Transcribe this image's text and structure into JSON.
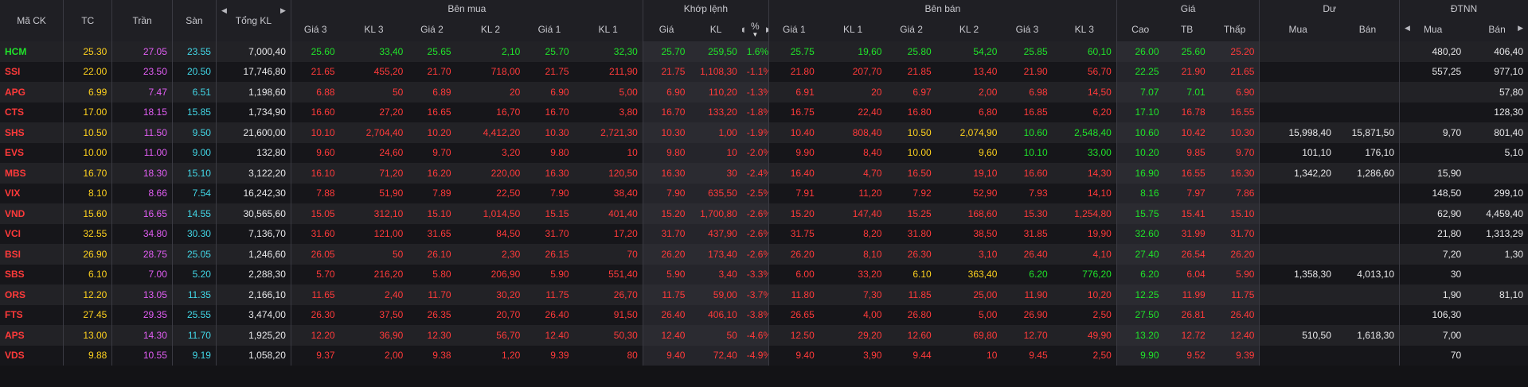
{
  "colors": {
    "up": "#20e32a",
    "down": "#ff3a3a",
    "reference": "#ffd21e",
    "ceiling": "#e35ef5",
    "floor": "#42d8e8",
    "neutral": "#e8e8ea"
  },
  "icons": [
    "arrow-left-icon",
    "arrow-right-icon",
    "sort-desc-icon"
  ],
  "header": {
    "groups": {
      "symbol": "Mã CK",
      "ref": "TC",
      "ceiling": "Trần",
      "floor": "Sàn",
      "total_volume": "Tổng KL",
      "bid": "Bên mua",
      "match": "Khớp lệnh",
      "ask": "Bên bán",
      "price": "Giá",
      "residual": "Dư",
      "foreign": "ĐTNN"
    },
    "sub": {
      "bid_p3": "Giá 3",
      "bid_v3": "KL 3",
      "bid_p2": "Giá 2",
      "bid_v2": "KL 2",
      "bid_p1": "Giá 1",
      "bid_v1": "KL 1",
      "match_p": "Giá",
      "match_v": "KL",
      "match_pct": "%",
      "ask_p1": "Giá 1",
      "ask_v1": "KL 1",
      "ask_p2": "Giá 2",
      "ask_v2": "KL 2",
      "ask_p3": "Giá 3",
      "ask_v3": "KL 3",
      "high": "Cao",
      "avg": "TB",
      "low": "Thấp",
      "res_buy": "Mua",
      "res_sell": "Bán",
      "frn_buy": "Mua",
      "frn_sell": "Bán"
    }
  },
  "rows": [
    {
      "sym": "HCM",
      "ref": "25.30",
      "ceil": "27.05",
      "floor": "23.55",
      "total": "7,000,40",
      "b3": "25.60",
      "bv3": "33,40",
      "b2": "25.65",
      "bv2": "2,10",
      "b1": "25.70",
      "bv1": "32,30",
      "mp": "25.70",
      "mv": "259,50",
      "pct": "1.6%",
      "a1": "25.75",
      "av1": "19,60",
      "a2": "25.80",
      "av2": "54,20",
      "a3": "25.85",
      "av3": "60,10",
      "hi": "26.00",
      "avg": "25.60",
      "lo": "25.20",
      "rb": "",
      "rs": "",
      "fb": "480,20",
      "fs": "406,40",
      "c": {
        "sym": "up",
        "b3": "up",
        "b2": "up",
        "b1": "up",
        "m": "up",
        "a1": "up",
        "a2": "up",
        "a3": "up",
        "hi": "up",
        "avg": "up",
        "lo": "down"
      }
    },
    {
      "sym": "SSI",
      "ref": "22.00",
      "ceil": "23.50",
      "floor": "20.50",
      "total": "17,746,80",
      "b3": "21.65",
      "bv3": "455,20",
      "b2": "21.70",
      "bv2": "718,00",
      "b1": "21.75",
      "bv1": "211,90",
      "mp": "21.75",
      "mv": "1,108,30",
      "pct": "-1.1%",
      "a1": "21.80",
      "av1": "207,70",
      "a2": "21.85",
      "av2": "13,40",
      "a3": "21.90",
      "av3": "56,70",
      "hi": "22.25",
      "avg": "21.90",
      "lo": "21.65",
      "rb": "",
      "rs": "",
      "fb": "557,25",
      "fs": "977,10",
      "c": {
        "sym": "down",
        "b3": "down",
        "b2": "down",
        "b1": "down",
        "m": "down",
        "a1": "down",
        "a2": "down",
        "a3": "down",
        "hi": "up",
        "avg": "down",
        "lo": "down"
      }
    },
    {
      "sym": "APG",
      "ref": "6.99",
      "ceil": "7.47",
      "floor": "6.51",
      "total": "1,198,60",
      "b3": "6.88",
      "bv3": "50",
      "b2": "6.89",
      "bv2": "20",
      "b1": "6.90",
      "bv1": "5,00",
      "mp": "6.90",
      "mv": "110,20",
      "pct": "-1.3%",
      "a1": "6.91",
      "av1": "20",
      "a2": "6.97",
      "av2": "2,00",
      "a3": "6.98",
      "av3": "14,50",
      "hi": "7.07",
      "avg": "7.01",
      "lo": "6.90",
      "rb": "",
      "rs": "",
      "fb": "",
      "fs": "57,80",
      "c": {
        "sym": "down",
        "b3": "down",
        "b2": "down",
        "b1": "down",
        "m": "down",
        "a1": "down",
        "a2": "down",
        "a3": "down",
        "hi": "up",
        "avg": "up",
        "lo": "down"
      }
    },
    {
      "sym": "CTS",
      "ref": "17.00",
      "ceil": "18.15",
      "floor": "15.85",
      "total": "1,734,90",
      "b3": "16.60",
      "bv3": "27,20",
      "b2": "16.65",
      "bv2": "16,70",
      "b1": "16.70",
      "bv1": "3,80",
      "mp": "16.70",
      "mv": "133,20",
      "pct": "-1.8%",
      "a1": "16.75",
      "av1": "22,40",
      "a2": "16.80",
      "av2": "6,80",
      "a3": "16.85",
      "av3": "6,20",
      "hi": "17.10",
      "avg": "16.78",
      "lo": "16.55",
      "rb": "",
      "rs": "",
      "fb": "",
      "fs": "128,30",
      "c": {
        "sym": "down",
        "b3": "down",
        "b2": "down",
        "b1": "down",
        "m": "down",
        "a1": "down",
        "a2": "down",
        "a3": "down",
        "hi": "up",
        "avg": "down",
        "lo": "down"
      }
    },
    {
      "sym": "SHS",
      "ref": "10.50",
      "ceil": "11.50",
      "floor": "9.50",
      "total": "21,600,00",
      "b3": "10.10",
      "bv3": "2,704,40",
      "b2": "10.20",
      "bv2": "4,412,20",
      "b1": "10.30",
      "bv1": "2,721,30",
      "mp": "10.30",
      "mv": "1,00",
      "pct": "-1.9%",
      "a1": "10.40",
      "av1": "808,40",
      "a2": "10.50",
      "av2": "2,074,90",
      "a3": "10.60",
      "av3": "2,548,40",
      "hi": "10.60",
      "avg": "10.42",
      "lo": "10.30",
      "rb": "15,998,40",
      "rs": "15,871,50",
      "fb": "9,70",
      "fs": "801,40",
      "c": {
        "sym": "down",
        "b3": "down",
        "b2": "down",
        "b1": "down",
        "m": "down",
        "a1": "down",
        "a2": "ref",
        "a3": "up",
        "hi": "up",
        "avg": "down",
        "lo": "down"
      }
    },
    {
      "sym": "EVS",
      "ref": "10.00",
      "ceil": "11.00",
      "floor": "9.00",
      "total": "132,80",
      "b3": "9.60",
      "bv3": "24,60",
      "b2": "9.70",
      "bv2": "3,20",
      "b1": "9.80",
      "bv1": "10",
      "mp": "9.80",
      "mv": "10",
      "pct": "-2.0%",
      "a1": "9.90",
      "av1": "8,40",
      "a2": "10.00",
      "av2": "9,60",
      "a3": "10.10",
      "av3": "33,00",
      "hi": "10.20",
      "avg": "9.85",
      "lo": "9.70",
      "rb": "101,10",
      "rs": "176,10",
      "fb": "",
      "fs": "5,10",
      "c": {
        "sym": "down",
        "b3": "down",
        "b2": "down",
        "b1": "down",
        "m": "down",
        "a1": "down",
        "a2": "ref",
        "a3": "up",
        "hi": "up",
        "avg": "down",
        "lo": "down"
      }
    },
    {
      "sym": "MBS",
      "ref": "16.70",
      "ceil": "18.30",
      "floor": "15.10",
      "total": "3,122,20",
      "b3": "16.10",
      "bv3": "71,20",
      "b2": "16.20",
      "bv2": "220,00",
      "b1": "16.30",
      "bv1": "120,50",
      "mp": "16.30",
      "mv": "30",
      "pct": "-2.4%",
      "a1": "16.40",
      "av1": "4,70",
      "a2": "16.50",
      "av2": "19,10",
      "a3": "16.60",
      "av3": "14,30",
      "hi": "16.90",
      "avg": "16.55",
      "lo": "16.30",
      "rb": "1,342,20",
      "rs": "1,286,60",
      "fb": "15,90",
      "fs": "",
      "c": {
        "sym": "down",
        "b3": "down",
        "b2": "down",
        "b1": "down",
        "m": "down",
        "a1": "down",
        "a2": "down",
        "a3": "down",
        "hi": "up",
        "avg": "down",
        "lo": "down"
      }
    },
    {
      "sym": "VIX",
      "ref": "8.10",
      "ceil": "8.66",
      "floor": "7.54",
      "total": "16,242,30",
      "b3": "7.88",
      "bv3": "51,90",
      "b2": "7.89",
      "bv2": "22,50",
      "b1": "7.90",
      "bv1": "38,40",
      "mp": "7.90",
      "mv": "635,50",
      "pct": "-2.5%",
      "a1": "7.91",
      "av1": "11,20",
      "a2": "7.92",
      "av2": "52,90",
      "a3": "7.93",
      "av3": "14,10",
      "hi": "8.16",
      "avg": "7.97",
      "lo": "7.86",
      "rb": "",
      "rs": "",
      "fb": "148,50",
      "fs": "299,10",
      "c": {
        "sym": "down",
        "b3": "down",
        "b2": "down",
        "b1": "down",
        "m": "down",
        "a1": "down",
        "a2": "down",
        "a3": "down",
        "hi": "up",
        "avg": "down",
        "lo": "down"
      }
    },
    {
      "sym": "VND",
      "ref": "15.60",
      "ceil": "16.65",
      "floor": "14.55",
      "total": "30,565,60",
      "b3": "15.05",
      "bv3": "312,10",
      "b2": "15.10",
      "bv2": "1,014,50",
      "b1": "15.15",
      "bv1": "401,40",
      "mp": "15.20",
      "mv": "1,700,80",
      "pct": "-2.6%",
      "a1": "15.20",
      "av1": "147,40",
      "a2": "15.25",
      "av2": "168,60",
      "a3": "15.30",
      "av3": "1,254,80",
      "hi": "15.75",
      "avg": "15.41",
      "lo": "15.10",
      "rb": "",
      "rs": "",
      "fb": "62,90",
      "fs": "4,459,40",
      "c": {
        "sym": "down",
        "b3": "down",
        "b2": "down",
        "b1": "down",
        "m": "down",
        "a1": "down",
        "a2": "down",
        "a3": "down",
        "hi": "up",
        "avg": "down",
        "lo": "down"
      }
    },
    {
      "sym": "VCI",
      "ref": "32.55",
      "ceil": "34.80",
      "floor": "30.30",
      "total": "7,136,70",
      "b3": "31.60",
      "bv3": "121,00",
      "b2": "31.65",
      "bv2": "84,50",
      "b1": "31.70",
      "bv1": "17,20",
      "mp": "31.70",
      "mv": "437,90",
      "pct": "-2.6%",
      "a1": "31.75",
      "av1": "8,20",
      "a2": "31.80",
      "av2": "38,50",
      "a3": "31.85",
      "av3": "19,90",
      "hi": "32.60",
      "avg": "31.99",
      "lo": "31.70",
      "rb": "",
      "rs": "",
      "fb": "21,80",
      "fs": "1,313,29",
      "c": {
        "sym": "down",
        "b3": "down",
        "b2": "down",
        "b1": "down",
        "m": "down",
        "a1": "down",
        "a2": "down",
        "a3": "down",
        "hi": "up",
        "avg": "down",
        "lo": "down"
      }
    },
    {
      "sym": "BSI",
      "ref": "26.90",
      "ceil": "28.75",
      "floor": "25.05",
      "total": "1,246,60",
      "b3": "26.05",
      "bv3": "50",
      "b2": "26.10",
      "bv2": "2,30",
      "b1": "26.15",
      "bv1": "70",
      "mp": "26.20",
      "mv": "173,40",
      "pct": "-2.6%",
      "a1": "26.20",
      "av1": "8,10",
      "a2": "26.30",
      "av2": "3,10",
      "a3": "26.40",
      "av3": "4,10",
      "hi": "27.40",
      "avg": "26.54",
      "lo": "26.20",
      "rb": "",
      "rs": "",
      "fb": "7,20",
      "fs": "1,30",
      "c": {
        "sym": "down",
        "b3": "down",
        "b2": "down",
        "b1": "down",
        "m": "down",
        "a1": "down",
        "a2": "down",
        "a3": "down",
        "hi": "up",
        "avg": "down",
        "lo": "down"
      }
    },
    {
      "sym": "SBS",
      "ref": "6.10",
      "ceil": "7.00",
      "floor": "5.20",
      "total": "2,288,30",
      "b3": "5.70",
      "bv3": "216,20",
      "b2": "5.80",
      "bv2": "206,90",
      "b1": "5.90",
      "bv1": "551,40",
      "mp": "5.90",
      "mv": "3,40",
      "pct": "-3.3%",
      "a1": "6.00",
      "av1": "33,20",
      "a2": "6.10",
      "av2": "363,40",
      "a3": "6.20",
      "av3": "776,20",
      "hi": "6.20",
      "avg": "6.04",
      "lo": "5.90",
      "rb": "1,358,30",
      "rs": "4,013,10",
      "fb": "30",
      "fs": "",
      "c": {
        "sym": "down",
        "b3": "down",
        "b2": "down",
        "b1": "down",
        "m": "down",
        "a1": "down",
        "a2": "ref",
        "a3": "up",
        "hi": "up",
        "avg": "down",
        "lo": "down"
      }
    },
    {
      "sym": "ORS",
      "ref": "12.20",
      "ceil": "13.05",
      "floor": "11.35",
      "total": "2,166,10",
      "b3": "11.65",
      "bv3": "2,40",
      "b2": "11.70",
      "bv2": "30,20",
      "b1": "11.75",
      "bv1": "26,70",
      "mp": "11.75",
      "mv": "59,00",
      "pct": "-3.7%",
      "a1": "11.80",
      "av1": "7,30",
      "a2": "11.85",
      "av2": "25,00",
      "a3": "11.90",
      "av3": "10,20",
      "hi": "12.25",
      "avg": "11.99",
      "lo": "11.75",
      "rb": "",
      "rs": "",
      "fb": "1,90",
      "fs": "81,10",
      "c": {
        "sym": "down",
        "b3": "down",
        "b2": "down",
        "b1": "down",
        "m": "down",
        "a1": "down",
        "a2": "down",
        "a3": "down",
        "hi": "up",
        "avg": "down",
        "lo": "down"
      }
    },
    {
      "sym": "FTS",
      "ref": "27.45",
      "ceil": "29.35",
      "floor": "25.55",
      "total": "3,474,00",
      "b3": "26.30",
      "bv3": "37,50",
      "b2": "26.35",
      "bv2": "20,70",
      "b1": "26.40",
      "bv1": "91,50",
      "mp": "26.40",
      "mv": "406,10",
      "pct": "-3.8%",
      "a1": "26.65",
      "av1": "4,00",
      "a2": "26.80",
      "av2": "5,00",
      "a3": "26.90",
      "av3": "2,50",
      "hi": "27.50",
      "avg": "26.81",
      "lo": "26.40",
      "rb": "",
      "rs": "",
      "fb": "106,30",
      "fs": "",
      "c": {
        "sym": "down",
        "b3": "down",
        "b2": "down",
        "b1": "down",
        "m": "down",
        "a1": "down",
        "a2": "down",
        "a3": "down",
        "hi": "up",
        "avg": "down",
        "lo": "down"
      }
    },
    {
      "sym": "APS",
      "ref": "13.00",
      "ceil": "14.30",
      "floor": "11.70",
      "total": "1,925,20",
      "b3": "12.20",
      "bv3": "36,90",
      "b2": "12.30",
      "bv2": "56,70",
      "b1": "12.40",
      "bv1": "50,30",
      "mp": "12.40",
      "mv": "50",
      "pct": "-4.6%",
      "a1": "12.50",
      "av1": "29,20",
      "a2": "12.60",
      "av2": "69,80",
      "a3": "12.70",
      "av3": "49,90",
      "hi": "13.20",
      "avg": "12.72",
      "lo": "12.40",
      "rb": "510,50",
      "rs": "1,618,30",
      "fb": "7,00",
      "fs": "",
      "c": {
        "sym": "down",
        "b3": "down",
        "b2": "down",
        "b1": "down",
        "m": "down",
        "a1": "down",
        "a2": "down",
        "a3": "down",
        "hi": "up",
        "avg": "down",
        "lo": "down"
      }
    },
    {
      "sym": "VDS",
      "ref": "9.88",
      "ceil": "10.55",
      "floor": "9.19",
      "total": "1,058,20",
      "b3": "9.37",
      "bv3": "2,00",
      "b2": "9.38",
      "bv2": "1,20",
      "b1": "9.39",
      "bv1": "80",
      "mp": "9.40",
      "mv": "72,40",
      "pct": "-4.9%",
      "a1": "9.40",
      "av1": "3,90",
      "a2": "9.44",
      "av2": "10",
      "a3": "9.45",
      "av3": "2,50",
      "hi": "9.90",
      "avg": "9.52",
      "lo": "9.39",
      "rb": "",
      "rs": "",
      "fb": "70",
      "fs": "",
      "c": {
        "sym": "down",
        "b3": "down",
        "b2": "down",
        "b1": "down",
        "m": "down",
        "a1": "down",
        "a2": "down",
        "a3": "down",
        "hi": "up",
        "avg": "down",
        "lo": "down"
      }
    }
  ]
}
